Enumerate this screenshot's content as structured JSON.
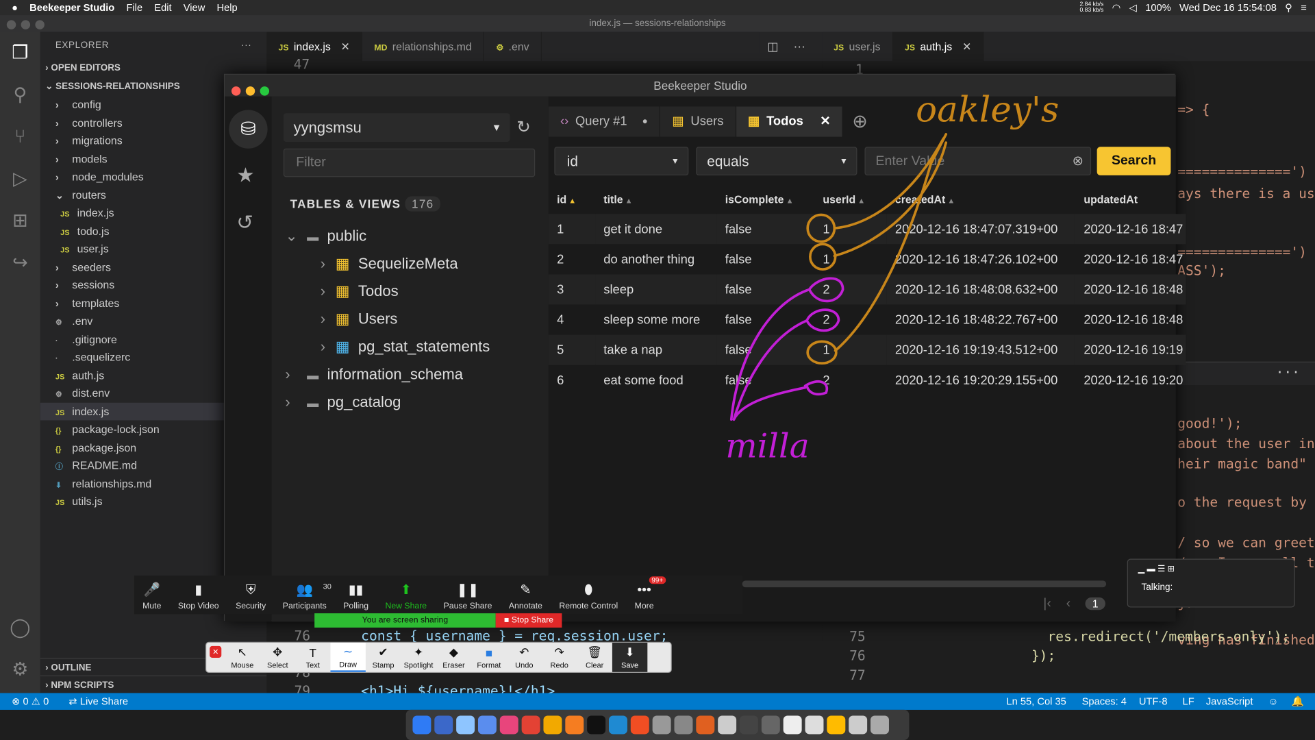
{
  "menubar": {
    "app": "Beekeeper Studio",
    "items": [
      "File",
      "Edit",
      "View",
      "Help"
    ],
    "net_up": "2.84 kb/s",
    "net_down": "0.83 kb/s",
    "battery": "100%",
    "datetime": "Wed Dec 16  15:54:08"
  },
  "vscode": {
    "title": "index.js — sessions-relationships",
    "explorer_label": "EXPLORER",
    "open_editors": "OPEN EDITORS",
    "project": "SESSIONS-RELATIONSHIPS",
    "tree": [
      {
        "label": "config",
        "type": "folder",
        "indent": 1
      },
      {
        "label": "controllers",
        "type": "folder",
        "indent": 1
      },
      {
        "label": "migrations",
        "type": "folder",
        "indent": 1
      },
      {
        "label": "models",
        "type": "folder",
        "indent": 1
      },
      {
        "label": "node_modules",
        "type": "folder",
        "indent": 1
      },
      {
        "label": "routers",
        "type": "folder-open",
        "indent": 1
      },
      {
        "label": "index.js",
        "type": "js",
        "indent": 2
      },
      {
        "label": "todo.js",
        "type": "js",
        "indent": 2
      },
      {
        "label": "user.js",
        "type": "js",
        "indent": 2
      },
      {
        "label": "seeders",
        "type": "folder",
        "indent": 1
      },
      {
        "label": "sessions",
        "type": "folder",
        "indent": 1
      },
      {
        "label": "templates",
        "type": "folder",
        "indent": 1
      },
      {
        "label": ".env",
        "type": "gear",
        "indent": 1
      },
      {
        "label": ".gitignore",
        "type": "dot",
        "indent": 1
      },
      {
        "label": ".sequelizerc",
        "type": "dot",
        "indent": 1
      },
      {
        "label": "auth.js",
        "type": "js",
        "indent": 1
      },
      {
        "label": "dist.env",
        "type": "gear",
        "indent": 1
      },
      {
        "label": "index.js",
        "type": "js",
        "indent": 1,
        "selected": true
      },
      {
        "label": "package-lock.json",
        "type": "json",
        "indent": 1
      },
      {
        "label": "package.json",
        "type": "json",
        "indent": 1
      },
      {
        "label": "README.md",
        "type": "info",
        "indent": 1
      },
      {
        "label": "relationships.md",
        "type": "md",
        "indent": 1
      },
      {
        "label": "utils.js",
        "type": "js",
        "indent": 1
      }
    ],
    "outline": "OUTLINE",
    "npm_scripts": "NPM SCRIPTS",
    "tabs_left": [
      {
        "label": "index.js",
        "icon": "JS",
        "active": true
      },
      {
        "label": "relationships.md",
        "icon": "MD"
      },
      {
        "label": ".env",
        "icon": "⚙"
      }
    ],
    "tabs_right": [
      {
        "label": "user.js",
        "icon": "JS"
      },
      {
        "label": "auth.js",
        "icon": "JS",
        "active": true
      }
    ],
    "left_line_top": "47",
    "right_line_top": "1",
    "left_code": [
      {
        "ln": "76",
        "text": "    const { username } = req.session.user;"
      },
      {
        "ln": "77",
        "text": ""
      },
      {
        "ln": "78",
        "text": ""
      },
      {
        "ln": "79",
        "text": "    <h1>Hi ${username}!</h1>"
      }
    ],
    "right_code_fragments": [
      "=> {",
      "==============')",
      "ays there is a us",
      "==============')",
      "ASS');",
      ";",
      "good!');",
      "about the user in",
      "heir magic band\"",
      "o the request by",
      "/ so we can greet",
      "/ so I can pull t",
      "ju",
      "ving has finished,"
    ],
    "right_code": [
      {
        "ln": "75",
        "text": "        res.redirect('/members-only');"
      },
      {
        "ln": "76",
        "text": "      });"
      },
      {
        "ln": "77",
        "text": ""
      }
    ],
    "status": {
      "errors": "0",
      "warnings": "0",
      "live_share": "Live Share",
      "position": "Ln 55, Col 35",
      "spaces": "Spaces: 4",
      "encoding": "UTF-8",
      "eol": "LF",
      "language": "JavaScript"
    }
  },
  "beekeeper": {
    "title": "Beekeeper Studio",
    "database": "yyngsmsu",
    "filter_placeholder": "Filter",
    "tables_views_label": "TABLES & VIEWS",
    "tables_count": "176",
    "schemas": [
      {
        "name": "public",
        "open": true,
        "tables": [
          {
            "name": "SequelizeMeta",
            "kind": "table"
          },
          {
            "name": "Todos",
            "kind": "table"
          },
          {
            "name": "Users",
            "kind": "table"
          },
          {
            "name": "pg_stat_statements",
            "kind": "view"
          }
        ]
      },
      {
        "name": "information_schema",
        "open": false,
        "tables": []
      },
      {
        "name": "pg_catalog",
        "open": false,
        "tables": []
      }
    ],
    "tabs": [
      {
        "label": "Query #1",
        "kind": "query"
      },
      {
        "label": "Users",
        "kind": "table"
      },
      {
        "label": "Todos",
        "kind": "table",
        "active": true
      }
    ],
    "filter": {
      "column": "id",
      "operator": "equals",
      "value_placeholder": "Enter Value",
      "search_label": "Search"
    },
    "columns": [
      "id",
      "title",
      "isComplete",
      "userId",
      "createdAt",
      "updatedAt"
    ],
    "rows": [
      [
        "1",
        "get it done",
        "false",
        "1",
        "2020-12-16 18:47:07.319+00",
        "2020-12-16 18:47"
      ],
      [
        "2",
        "do another thing",
        "false",
        "1",
        "2020-12-16 18:47:26.102+00",
        "2020-12-16 18:47"
      ],
      [
        "3",
        "sleep",
        "false",
        "2",
        "2020-12-16 18:48:08.632+00",
        "2020-12-16 18:48"
      ],
      [
        "4",
        "sleep some more",
        "false",
        "2",
        "2020-12-16 18:48:22.767+00",
        "2020-12-16 18:48"
      ],
      [
        "5",
        "take a nap",
        "false",
        "1",
        "2020-12-16 19:19:43.512+00",
        "2020-12-16 19:19"
      ],
      [
        "6",
        "eat some food",
        "false",
        "2",
        "2020-12-16 19:20:29.155+00",
        "2020-12-16 19:20"
      ]
    ],
    "page": "1"
  },
  "annotations": {
    "oakley": "oakley's",
    "milla": "milla",
    "oakley_color": "#c8861a",
    "milla_color": "#c21fd6"
  },
  "zoom": {
    "controls": [
      {
        "label": "Mute",
        "icon": "🎤"
      },
      {
        "label": "Stop Video",
        "icon": "▮"
      },
      {
        "label": "Security",
        "icon": "⛨"
      },
      {
        "label": "Participants",
        "icon": "👥",
        "count": "30"
      },
      {
        "label": "Polling",
        "icon": "▮▮"
      },
      {
        "label": "New Share",
        "icon": "⬆",
        "accent": true
      },
      {
        "label": "Pause Share",
        "icon": "❚❚"
      },
      {
        "label": "Annotate",
        "icon": "✎"
      },
      {
        "label": "Remote Control",
        "icon": "⬮"
      },
      {
        "label": "More",
        "icon": "•••",
        "badge": "99+"
      }
    ],
    "sharing_text": "You are screen sharing",
    "stop_share": "Stop Share",
    "draw_tools": [
      {
        "label": "Mouse",
        "icon": "↖"
      },
      {
        "label": "Select",
        "icon": "✥"
      },
      {
        "label": "Text",
        "icon": "T"
      },
      {
        "label": "Draw",
        "icon": "∼",
        "active": true
      },
      {
        "label": "Stamp",
        "icon": "✔"
      },
      {
        "label": "Spotlight",
        "icon": "✦"
      },
      {
        "label": "Eraser",
        "icon": "◆"
      },
      {
        "label": "Format",
        "icon": "■"
      },
      {
        "label": "Undo",
        "icon": "↶"
      },
      {
        "label": "Redo",
        "icon": "↷"
      },
      {
        "label": "Clear",
        "icon": "🗑"
      },
      {
        "label": "Save",
        "icon": "⬇"
      }
    ],
    "talking_label": "Talking:"
  }
}
